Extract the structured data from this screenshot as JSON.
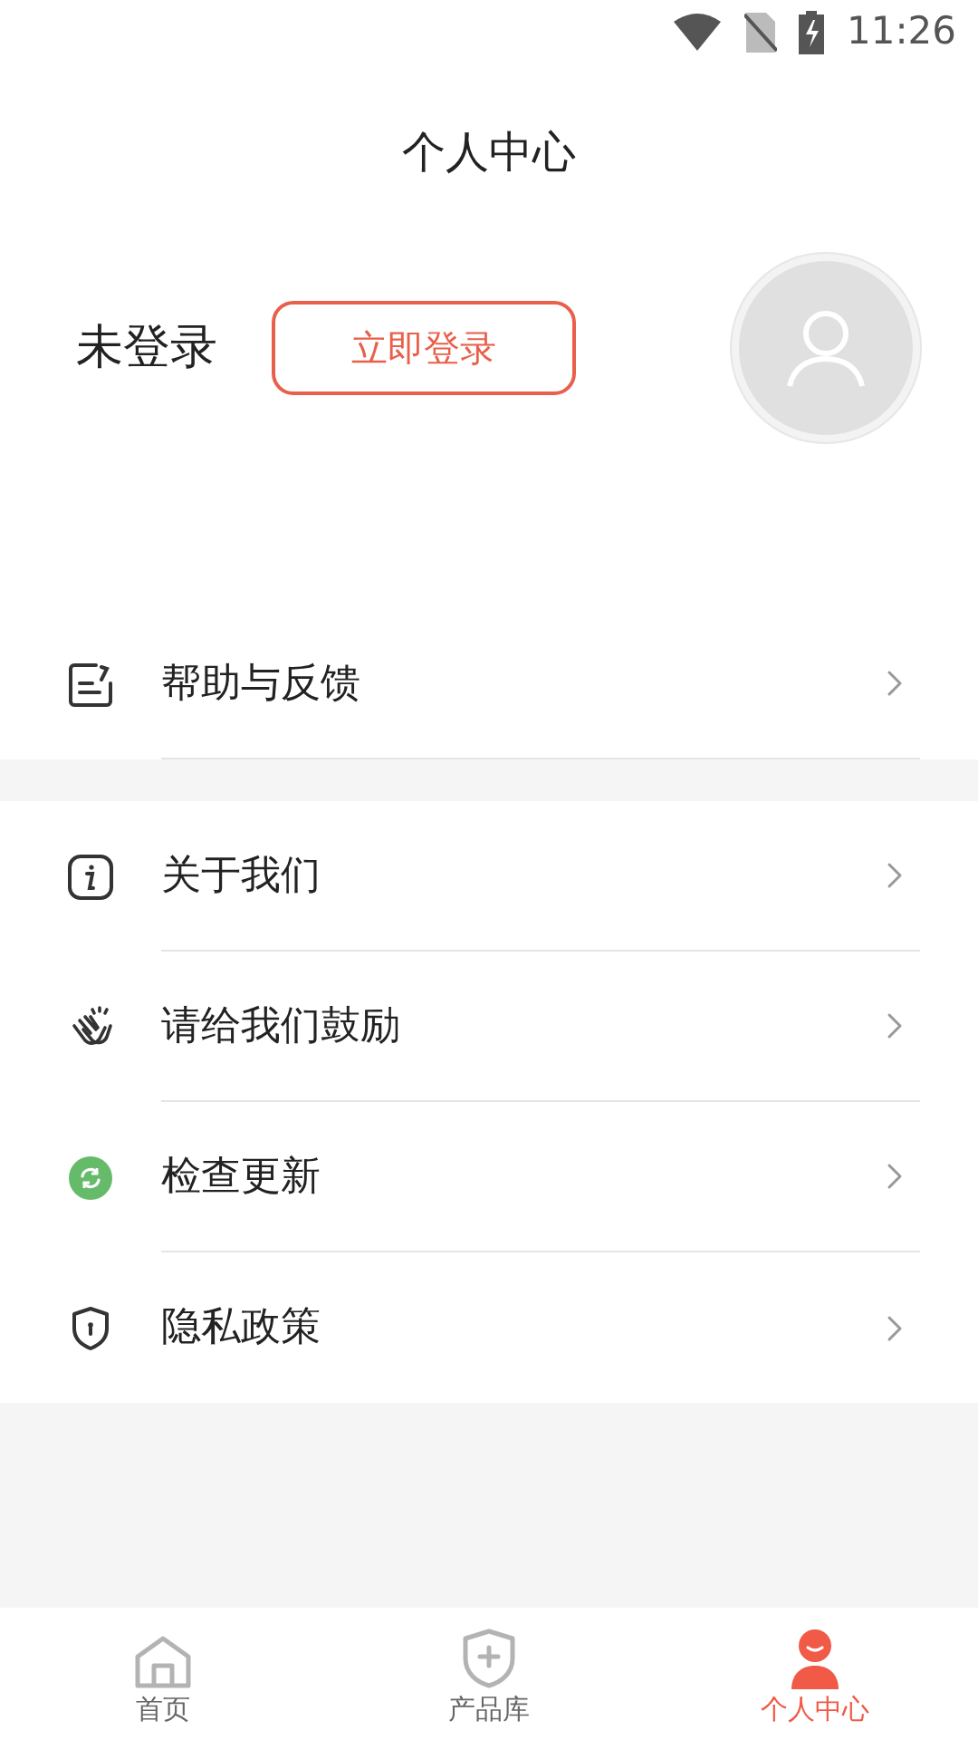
{
  "status_bar": {
    "time": "11:26"
  },
  "title": "个人中心",
  "profile": {
    "status": "未登录",
    "login_button": "立即登录"
  },
  "menu_groups": [
    [
      {
        "kind": "feedback",
        "label": "帮助与反馈"
      }
    ],
    [
      {
        "kind": "about",
        "label": "关于我们"
      },
      {
        "kind": "clap",
        "label": "请给我们鼓励"
      },
      {
        "kind": "update",
        "label": "检查更新"
      },
      {
        "kind": "privacy",
        "label": "隐私政策"
      }
    ]
  ],
  "tabs": [
    {
      "kind": "home",
      "label": "首页",
      "selected": false
    },
    {
      "kind": "products",
      "label": "产品库",
      "selected": false
    },
    {
      "kind": "profile",
      "label": "个人中心",
      "selected": true
    }
  ]
}
